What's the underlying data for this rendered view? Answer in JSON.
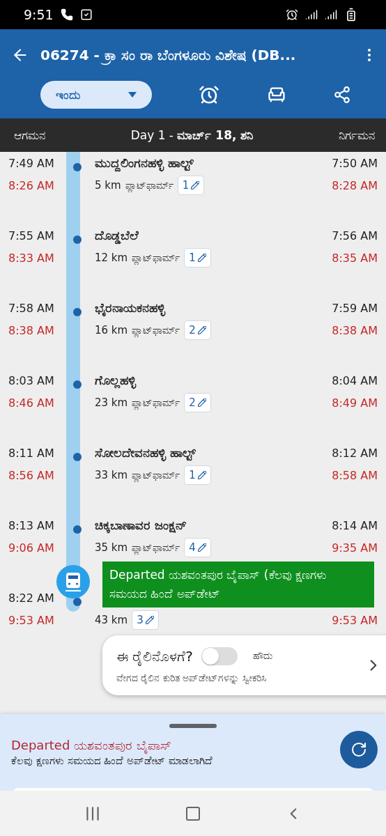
{
  "status_bar": {
    "time": "9:51"
  },
  "app_bar": {
    "title": "06274 - ಕ್ರಾ ಸಂ ರಾ ಬೆಂಗಳೂರು ವಿಶೇಷ (DB...",
    "date_selector": "ಇಂದು"
  },
  "day_bar": {
    "arrival_label": "ಆಗಮನ",
    "day": "Day 1 - **ಮಾರ್ಚ್ 18, ಶನಿ**",
    "departure_label": "ನಿರ್ಗಮನ"
  },
  "stations": [
    {
      "scheduled_arrival": "7:49 AM",
      "actual_arrival": "8:26 AM",
      "name": "ಮುದ್ದಲಿಂಗನಹಳ್ಳಿ ಹಾಲ್ಟ್",
      "distance": "5 km",
      "platform_label": "ಪ್ಲಾಟ್‌ಫಾರ್ಮ್",
      "platform": "1",
      "scheduled_departure": "7:50 AM",
      "actual_departure": "8:28 AM"
    },
    {
      "scheduled_arrival": "7:55 AM",
      "actual_arrival": "8:33 AM",
      "name": "ದೊಡ್ಡಬೆಲೆ",
      "distance": "12 km",
      "platform_label": "ಪ್ಲಾಟ್‌ಫಾರ್ಮ್",
      "platform": "1",
      "scheduled_departure": "7:56 AM",
      "actual_departure": "8:35 AM"
    },
    {
      "scheduled_arrival": "7:58 AM",
      "actual_arrival": "8:38 AM",
      "name": "ಭೈರನಾಯಕನಹಳ್ಳಿ",
      "distance": "16 km",
      "platform_label": "ಪ್ಲಾಟ್‌ಫಾರ್ಮ್",
      "platform": "2",
      "scheduled_departure": "7:59 AM",
      "actual_departure": "8:38 AM"
    },
    {
      "scheduled_arrival": "8:03 AM",
      "actual_arrival": "8:46 AM",
      "name": "ಗೊಲ್ಲಹಳ್ಳಿ",
      "distance": "23 km",
      "platform_label": "ಪ್ಲಾಟ್‌ಫಾರ್ಮ್",
      "platform": "2",
      "scheduled_departure": "8:04 AM",
      "actual_departure": "8:49 AM"
    },
    {
      "scheduled_arrival": "8:11 AM",
      "actual_arrival": "8:56 AM",
      "name": "ಸೋಲದೇವನಹಳ್ಳಿ ಹಾಲ್ಟ್",
      "distance": "33 km",
      "platform_label": "ಪ್ಲಾಟ್‌ಫಾರ್ಮ್",
      "platform": "1",
      "scheduled_departure": "8:12 AM",
      "actual_departure": "8:58 AM"
    },
    {
      "scheduled_arrival": "8:13 AM",
      "actual_arrival": "9:06 AM",
      "name": "ಚಿಕ್ಕಬಾಣಾವರ ಜಂಕ್ಷನ್",
      "distance": "35 km",
      "platform_label": "ಪ್ಲಾಟ್‌ಫಾರ್ಮ್",
      "platform": "4",
      "scheduled_departure": "8:14 AM",
      "actual_departure": "9:35 AM"
    },
    {
      "scheduled_arrival": "8:22 AM",
      "actual_arrival": "9:53 AM",
      "distance": "43 km",
      "platform": "3",
      "actual_departure": "9:53 AM"
    }
  ],
  "live_tooltip": {
    "text": "Departed ಯಶವಂತಪುರ ಬೈಪಾಸ್ (ಕೆಲವು ಕ್ಷಣಗಳು ಸಮಯದ ಹಿಂದೆ ಅಪ್‌ಡೇಟ್"
  },
  "onboard_card": {
    "question": "ಈ ರೈಲಿನೊಳಗೆ?",
    "on": false,
    "yes_label": "ಹೌದು",
    "subtitle": "ವೇಗದ ರೈಲಿನ ಕುರಿತ ಅಪ್‌ಡೇಟ್‌ಗಳನ್ನು ಸ್ವೀಕರಿಸಿ"
  },
  "bottom_sheet": {
    "status": "Departed ಯಶವಂತಪುರ ಬೈಪಾಸ್",
    "updated": "ಕೆಲವು ಕ್ಷಣಗಳು ಸಮಯದ ಹಿಂದೆ ಅಪ್‌ಡೇಟ್ ಮಾಡಲಾಗಿದೆ"
  }
}
